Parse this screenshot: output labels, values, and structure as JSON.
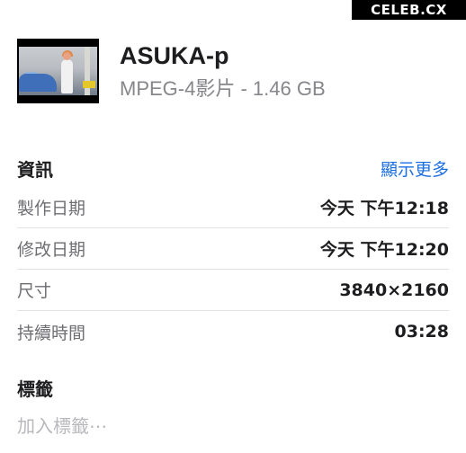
{
  "watermark": "CELEB.CX",
  "file": {
    "name": "ASUKA-p",
    "meta": "MPEG-4影片 - 1.46 GB"
  },
  "info": {
    "title": "資訊",
    "show_more": "顯示更多",
    "rows": [
      {
        "label": "製作日期",
        "value": "今天 下午12:18"
      },
      {
        "label": "修改日期",
        "value": "今天 下午12:20"
      },
      {
        "label": "尺寸",
        "value": "3840×2160"
      },
      {
        "label": "持續時間",
        "value": "03:28"
      }
    ]
  },
  "tags": {
    "title": "標籤",
    "placeholder": "加入標籤⋯"
  },
  "colors": {
    "accent": "#1b6fe0",
    "secondary_text": "#86868b",
    "primary_text": "#1d1d1f"
  }
}
